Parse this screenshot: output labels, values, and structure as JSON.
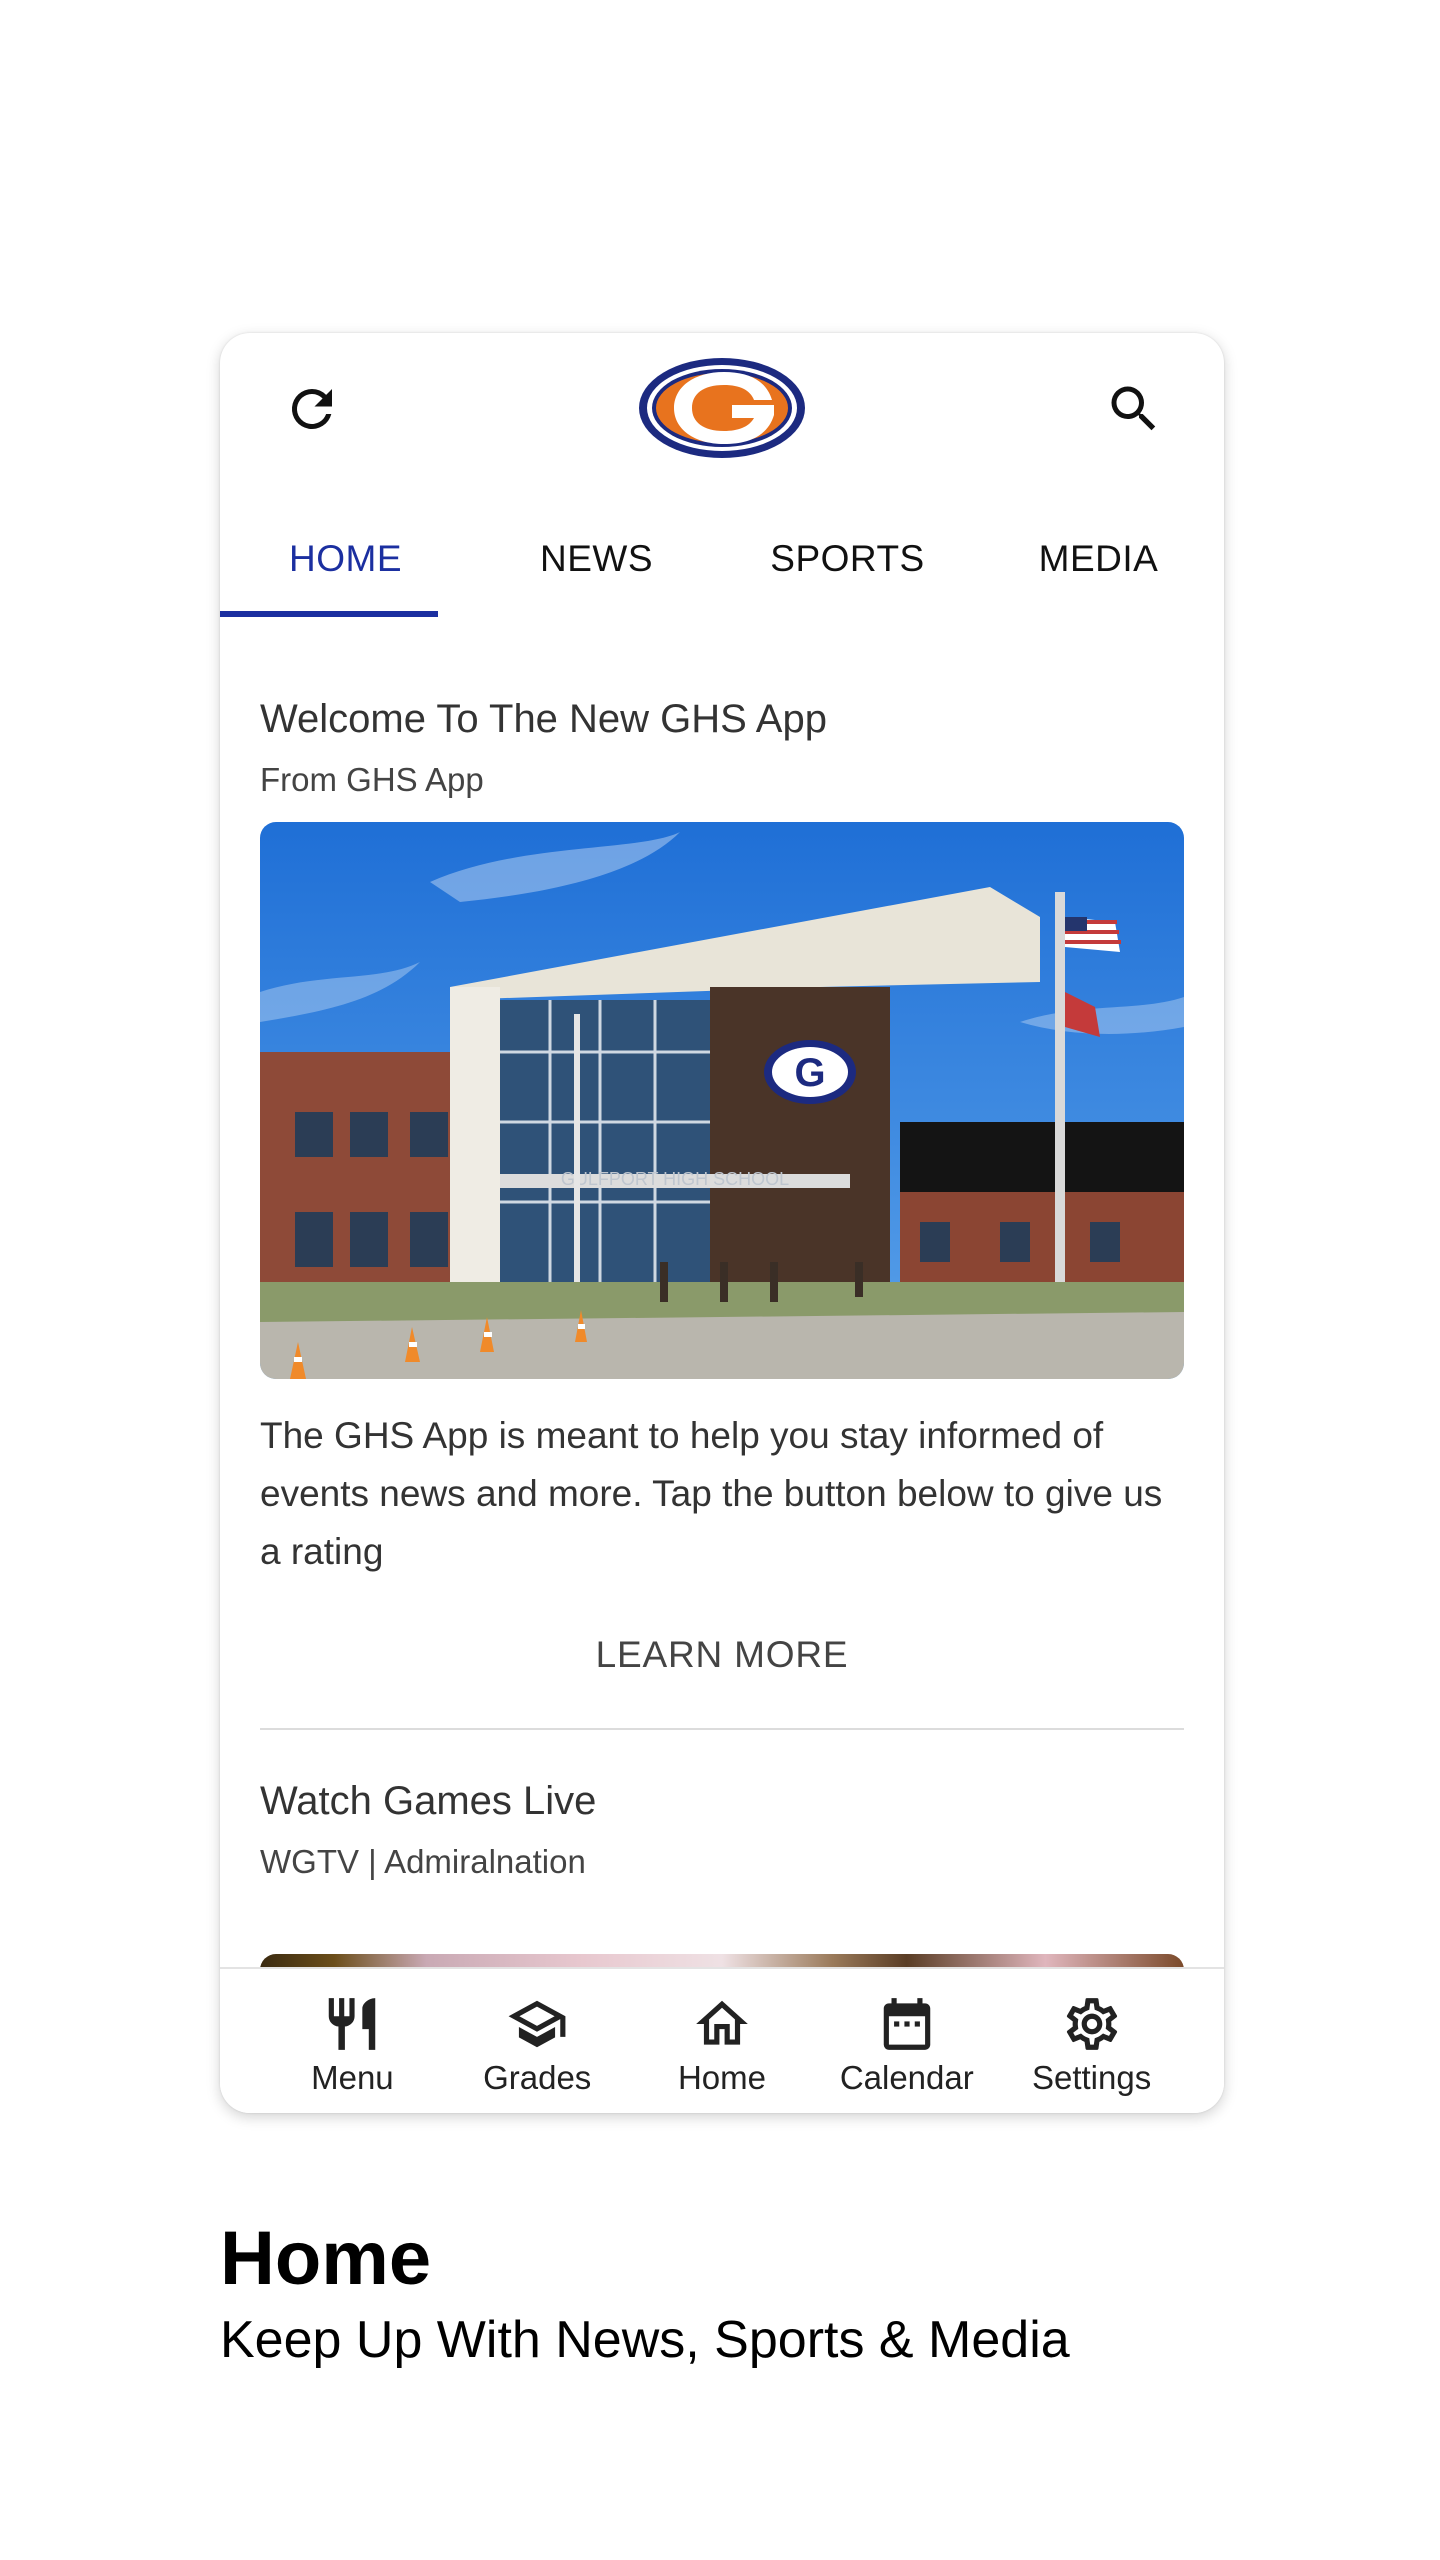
{
  "header": {
    "refresh_icon": "refresh-icon",
    "logo_letter": "G",
    "search_icon": "search-icon"
  },
  "tabs": [
    {
      "label": "HOME",
      "active": true
    },
    {
      "label": "NEWS",
      "active": false
    },
    {
      "label": "SPORTS",
      "active": false
    },
    {
      "label": "MEDIA",
      "active": false
    }
  ],
  "posts": [
    {
      "title": "Welcome To The New GHS App",
      "source": "From GHS App",
      "image_signage": "GULFPORT HIGH SCHOOL",
      "body": "The GHS App is meant to help you stay informed of events news and more. Tap the button below to give us a rating",
      "action": "LEARN MORE"
    },
    {
      "title": "Watch Games Live",
      "source": "WGTV | Admiralnation"
    }
  ],
  "bottom_nav": [
    {
      "label": "Menu",
      "icon": "fork-knife-icon"
    },
    {
      "label": "Grades",
      "icon": "graduation-cap-icon"
    },
    {
      "label": "Home",
      "icon": "home-icon"
    },
    {
      "label": "Calendar",
      "icon": "calendar-icon"
    },
    {
      "label": "Settings",
      "icon": "gear-icon"
    }
  ],
  "caption": {
    "title": "Home",
    "subtitle": "Keep Up With News, Sports & Media"
  },
  "colors": {
    "accent": "#1b2fa0",
    "logo_orange": "#e8731e",
    "logo_navy": "#1c2a80"
  }
}
